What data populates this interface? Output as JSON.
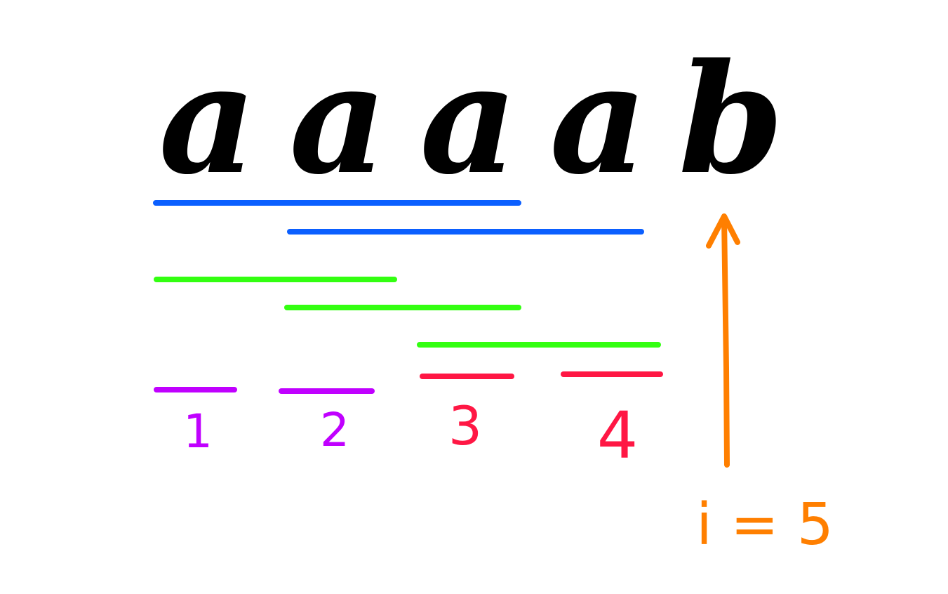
{
  "string": [
    "a",
    "a",
    "a",
    "a",
    "b"
  ],
  "labels": [
    "1",
    "2",
    "3",
    "4"
  ],
  "pointer": {
    "text": "i = 5"
  },
  "colors": {
    "letters": "#000000",
    "blue": "#0b5fff",
    "green": "#33ff11",
    "purple": "#c000ff",
    "red": "#ff1744",
    "orange": "#ff7f00"
  }
}
